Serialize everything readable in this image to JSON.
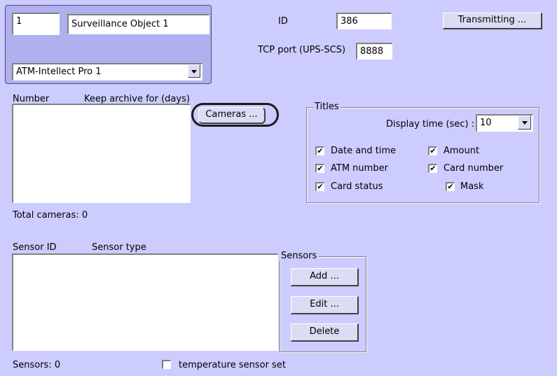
{
  "object": {
    "number": "1",
    "name": "Surveillance Object 1",
    "atm": "ATM-Intellect Pro 1"
  },
  "id": {
    "label": "ID",
    "value": "386"
  },
  "tcp": {
    "label": "TCP port (UPS-SCS)",
    "value": "8888"
  },
  "buttons": {
    "transmitting": "Transmitting ...",
    "cameras": "Cameras ...",
    "add": "Add ...",
    "edit": "Edit ...",
    "delete": "Delete"
  },
  "cameras_list": {
    "col_number": "Number",
    "col_archive": "Keep archive for (days)",
    "total": "Total cameras: 0"
  },
  "titles": {
    "legend": "Titles",
    "display_time_label": "Display time (sec) :",
    "display_time_value": "10",
    "checks": {
      "date_time": "Date and time",
      "amount": "Amount",
      "atm_number": "ATM number",
      "card_number": "Card number",
      "card_status": "Card status",
      "mask": "Mask"
    }
  },
  "sensors_list": {
    "col_id": "Sensor ID",
    "col_type": "Sensor type",
    "total": "Sensors: 0"
  },
  "sensors_group": {
    "legend": "Sensors"
  },
  "temp": {
    "label": "temperature sensor set"
  },
  "check_mark": "✔"
}
